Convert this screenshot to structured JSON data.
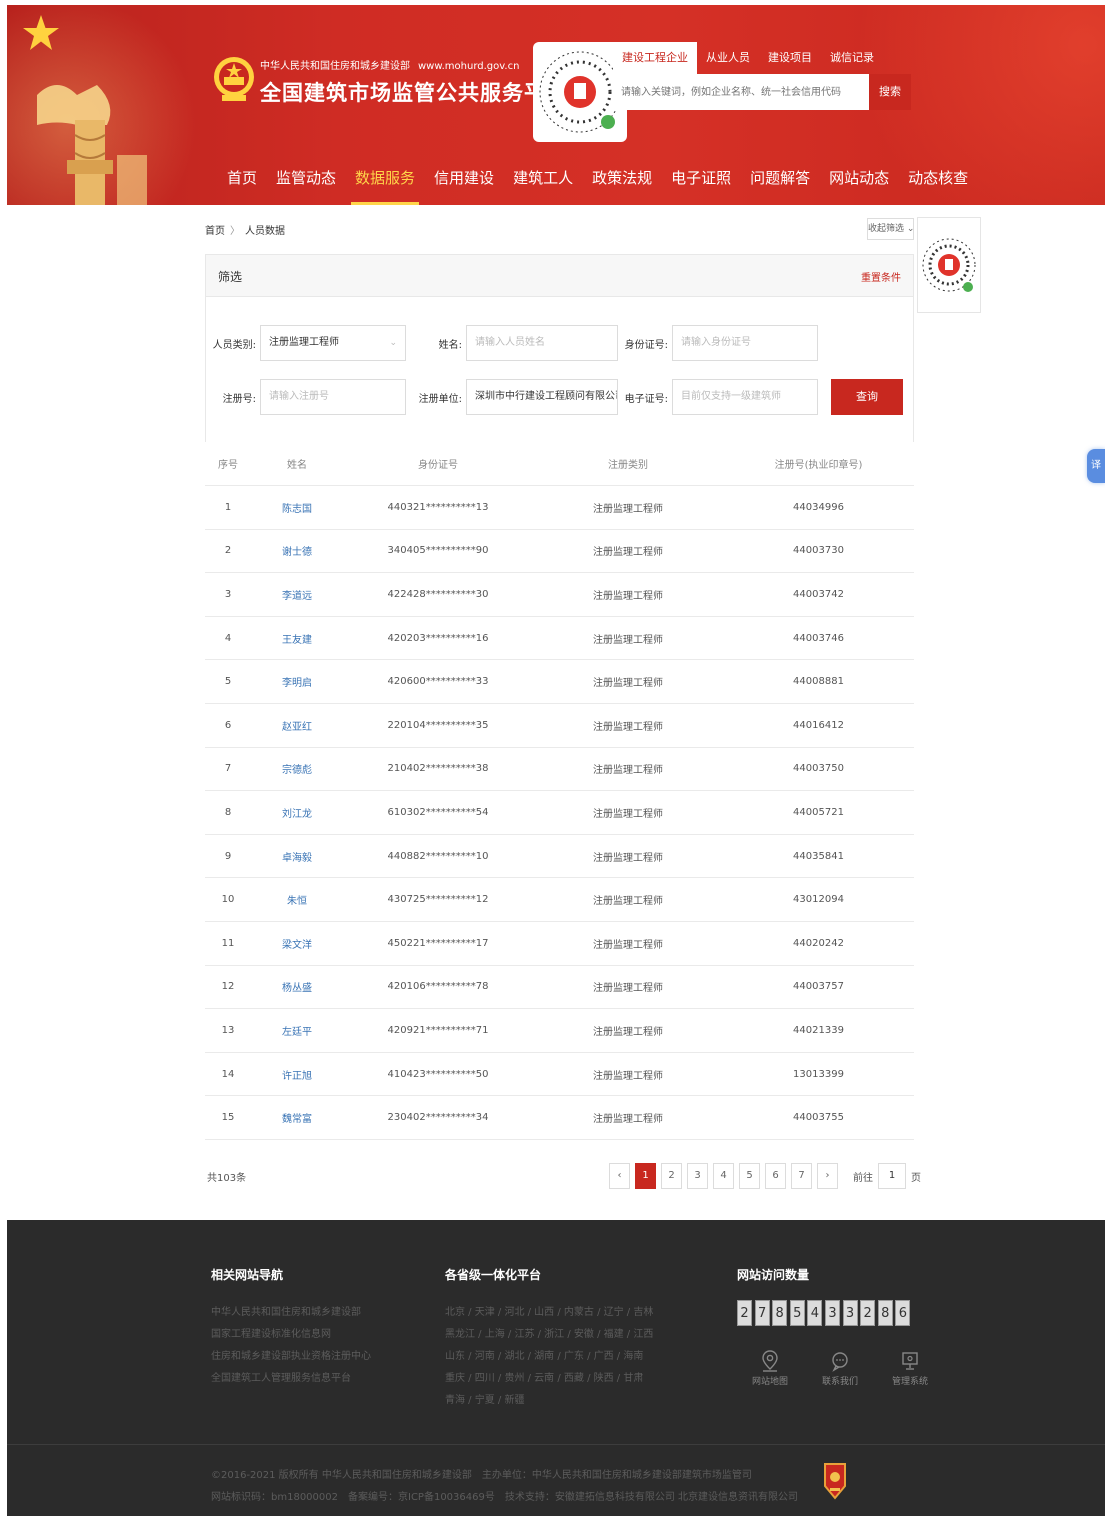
{
  "header": {
    "org_name": "中华人民共和国住房和城乡建设部",
    "url": "www.mohurd.gov.cn",
    "platform_title": "全国建筑市场监管公共服务平台",
    "search": {
      "tabs": [
        "建设工程企业",
        "从业人员",
        "建设项目",
        "诚信记录"
      ],
      "active_tab": 0,
      "placeholder": "请输入关键词，例如企业名称、统一社会信用代码",
      "button_label": "搜索"
    },
    "nav": [
      "首页",
      "监管动态",
      "数据服务",
      "信用建设",
      "建筑工人",
      "政策法规",
      "电子证照",
      "问题解答",
      "网站动态",
      "动态核查"
    ],
    "active_nav": 2
  },
  "breadcrumb": {
    "home": "首页",
    "sep": "〉",
    "current": "人员数据"
  },
  "collapse_label": "收起筛选",
  "filter": {
    "title": "筛选",
    "reset_label": "重置条件",
    "person_type_label": "人员类别:",
    "person_type_value": "注册监理工程师",
    "name_label": "姓名:",
    "name_placeholder": "请输入人员姓名",
    "idcard_label": "身份证号:",
    "idcard_placeholder": "请输入身份证号",
    "reg_no_label": "注册号:",
    "reg_no_placeholder": "请输入注册号",
    "reg_unit_label": "注册单位:",
    "reg_unit_value": "深圳市中行建设工程顾问有限公司",
    "ecert_label": "电子证号:",
    "ecert_placeholder": "目前仅支持一级建筑师",
    "query_label": "查询"
  },
  "table": {
    "headers": [
      "序号",
      "姓名",
      "身份证号",
      "注册类别",
      "注册号(执业印章号)"
    ],
    "rows": [
      [
        "1",
        "陈志国",
        "440321**********13",
        "注册监理工程师",
        "44034996"
      ],
      [
        "2",
        "谢士德",
        "340405**********90",
        "注册监理工程师",
        "44003730"
      ],
      [
        "3",
        "李道远",
        "422428**********30",
        "注册监理工程师",
        "44003742"
      ],
      [
        "4",
        "王友建",
        "420203**********16",
        "注册监理工程师",
        "44003746"
      ],
      [
        "5",
        "李明启",
        "420600**********33",
        "注册监理工程师",
        "44008881"
      ],
      [
        "6",
        "赵亚红",
        "220104**********35",
        "注册监理工程师",
        "44016412"
      ],
      [
        "7",
        "宗德彪",
        "210402**********38",
        "注册监理工程师",
        "44003750"
      ],
      [
        "8",
        "刘江龙",
        "610302**********54",
        "注册监理工程师",
        "44005721"
      ],
      [
        "9",
        "卓海毅",
        "440882**********10",
        "注册监理工程师",
        "44035841"
      ],
      [
        "10",
        "朱恒",
        "430725**********12",
        "注册监理工程师",
        "43012094"
      ],
      [
        "11",
        "梁文洋",
        "450221**********17",
        "注册监理工程师",
        "44020242"
      ],
      [
        "12",
        "杨丛盛",
        "420106**********78",
        "注册监理工程师",
        "44003757"
      ],
      [
        "13",
        "左廷平",
        "420921**********71",
        "注册监理工程师",
        "44021339"
      ],
      [
        "14",
        "许正旭",
        "410423**********50",
        "注册监理工程师",
        "13013399"
      ],
      [
        "15",
        "魏常富",
        "230402**********34",
        "注册监理工程师",
        "44003755"
      ]
    ]
  },
  "pagination": {
    "total": "共103条",
    "prev": "‹",
    "next": "›",
    "pages": [
      "1",
      "2",
      "3",
      "4",
      "5",
      "6",
      "7"
    ],
    "active": 0,
    "goto_prefix": "前往",
    "goto_value": "1",
    "goto_suffix": "页"
  },
  "float_tab": "译",
  "footer": {
    "nav_title": "相关网站导航",
    "nav_links": [
      "中华人民共和国住房和城乡建设部",
      "国家工程建设标准化信息网",
      "住房和城乡建设部执业资格注册中心",
      "全国建筑工人管理服务信息平台"
    ],
    "platform_title": "各省级一体化平台",
    "platform_lines": [
      "北京 / 天津 / 河北 / 山西 / 内蒙古 / 辽宁 / 吉林",
      "黑龙江 / 上海 / 江苏 / 浙江 / 安徽 / 福建 / 江西",
      "山东 / 河南 / 湖北 / 湖南 / 广东 / 广西 / 海南",
      "重庆 / 四川 / 贵州 / 云南 / 西藏 / 陕西 / 甘肃",
      "青海 / 宁夏 / 新疆"
    ],
    "visits_title": "网站访问数量",
    "visit_digits": [
      "2",
      "7",
      "8",
      "5",
      "4",
      "3",
      "3",
      "2",
      "8",
      "6"
    ],
    "icons": [
      {
        "label": "网站地图",
        "icon": "map-pin-icon"
      },
      {
        "label": "联系我们",
        "icon": "chat-icon"
      },
      {
        "label": "管理系统",
        "icon": "monitor-icon"
      }
    ],
    "copyright_1": "©2016-2021 版权所有 中华人民共和国住房和城乡建设部",
    "copyright_1b": "主办单位：中华人民共和国住房和城乡建设部建筑市场监管司",
    "copyright_2": "网站标识码：bm18000002",
    "copyright_2b": "备案编号：京ICP备10036469号",
    "copyright_2c": "技术支持：安徽建拓信息科技有限公司 北京建设信息资讯有限公司"
  },
  "colors": {
    "brand_red": "#c8281f",
    "nav_active": "#ffd54a",
    "link_blue": "#3a74b5",
    "footer_bg": "#2b2b2b"
  }
}
